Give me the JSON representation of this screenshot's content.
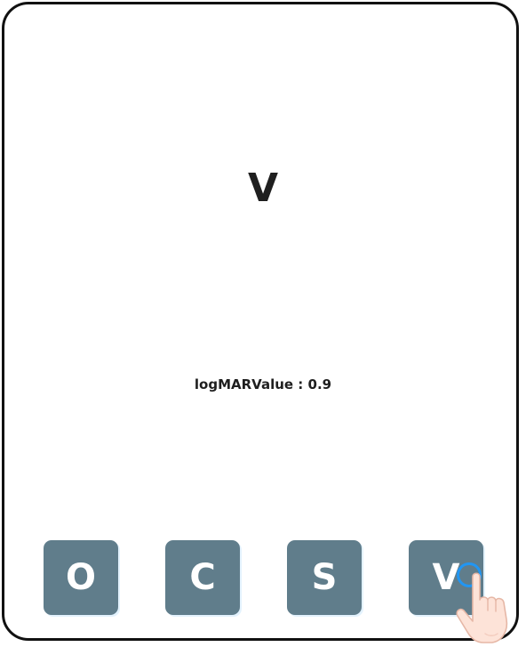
{
  "test": {
    "current_letter": "V",
    "logmar_text": "logMARValue : 0.9"
  },
  "choices": [
    {
      "label": "O"
    },
    {
      "label": "C"
    },
    {
      "label": "S"
    },
    {
      "label": "V"
    }
  ],
  "colors": {
    "button_bg": "#607d8b",
    "button_text": "#ffffff",
    "tap_ring": "#2196f3",
    "frame_border": "#111111"
  },
  "icons": {
    "pointer": "tap-hand-icon"
  }
}
